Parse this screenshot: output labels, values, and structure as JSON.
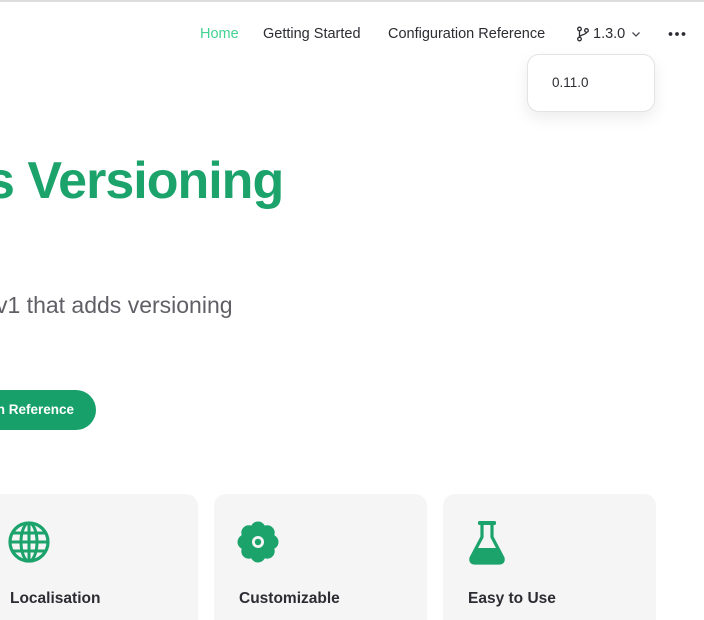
{
  "nav": {
    "home": "Home",
    "getting_started": "Getting Started",
    "config_reference": "Configuration Reference",
    "version": "1.3.0"
  },
  "version_menu": {
    "items": [
      "0.11.0"
    ]
  },
  "hero": {
    "title": "s Versioning",
    "tagline": "v1 that adds versioning",
    "cta_label": "n Reference"
  },
  "features": [
    {
      "title": "Localisation",
      "icon": "globe-icon"
    },
    {
      "title": "Customizable",
      "icon": "flower-icon"
    },
    {
      "title": "Easy to Use",
      "icon": "flask-icon"
    }
  ],
  "colors": {
    "brand": "#1ba36b",
    "nav_active": "#42d392",
    "button": "#17a06a",
    "card_bg": "#f5f5f5"
  }
}
